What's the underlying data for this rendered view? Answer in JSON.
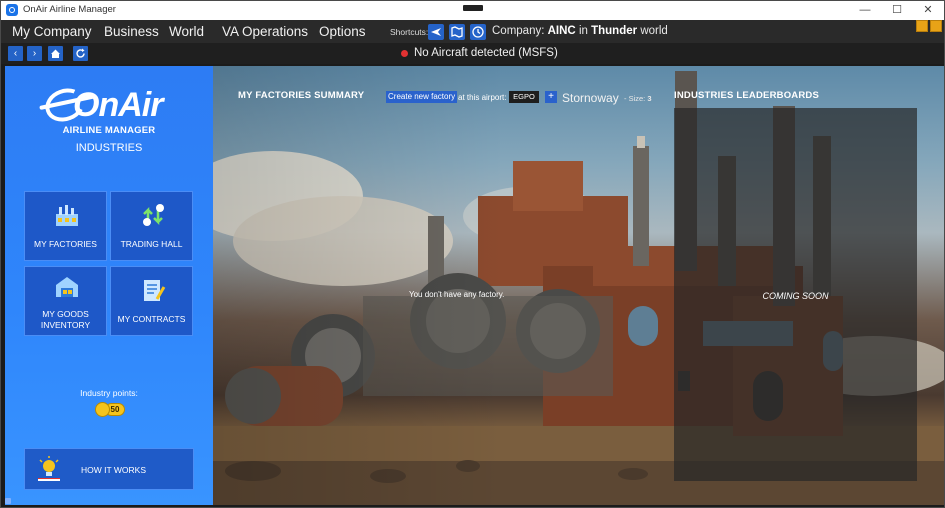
{
  "window": {
    "title": "OnAir Airline Manager",
    "controls": [
      "—",
      "☐",
      "✕"
    ]
  },
  "menu": {
    "items": [
      "My Company",
      "Business",
      "World",
      "VA Operations",
      "Options"
    ],
    "shortcuts_label": "Shortcuts:",
    "shortcut_icons": [
      "planes-icon",
      "map-icon",
      "clock-icon"
    ],
    "company_prefix": "Company:",
    "company_code": "AINC",
    "company_mid": "in",
    "world_name": "Thunder",
    "world_suffix": "world"
  },
  "nav": {
    "back": "‹",
    "forward": "›",
    "status_text": "No Aircraft detected (MSFS)",
    "status_color": "#e23232"
  },
  "sidebar": {
    "logo_text": "OnAir",
    "subtitle": "AIRLINE MANAGER",
    "section": "INDUSTRIES",
    "tiles": [
      {
        "label": "MY FACTORIES",
        "icon": "factory-icon"
      },
      {
        "label": "TRADING HALL",
        "icon": "buy-sell-icon"
      },
      {
        "label": "MY GOODS\nINVENTORY",
        "icon": "warehouse-icon"
      },
      {
        "label": "MY CONTRACTS",
        "icon": "contract-icon"
      }
    ],
    "industry_points_label": "Industry points:",
    "industry_points_value": "50",
    "how_it_works": "HOW IT WORKS"
  },
  "factories": {
    "title": "MY FACTORIES SUMMARY",
    "create_label": "Create new factory",
    "at_airport_label": "at this airport:",
    "airport_code": "EGPO",
    "plus": "+",
    "airport_name": "Stornoway",
    "size_label": "- Size:",
    "size_value": "3",
    "empty_message": "You don't have any factory."
  },
  "leaderboards": {
    "title": "INDUSTRIES LEADERBOARDS",
    "coming_soon": "COMING SOON"
  },
  "colors": {
    "accent_blue": "#2463c7",
    "sidebar_blue": "#2f86fb",
    "menubar": "#2a2a2a",
    "gold": "#f5c41c"
  }
}
